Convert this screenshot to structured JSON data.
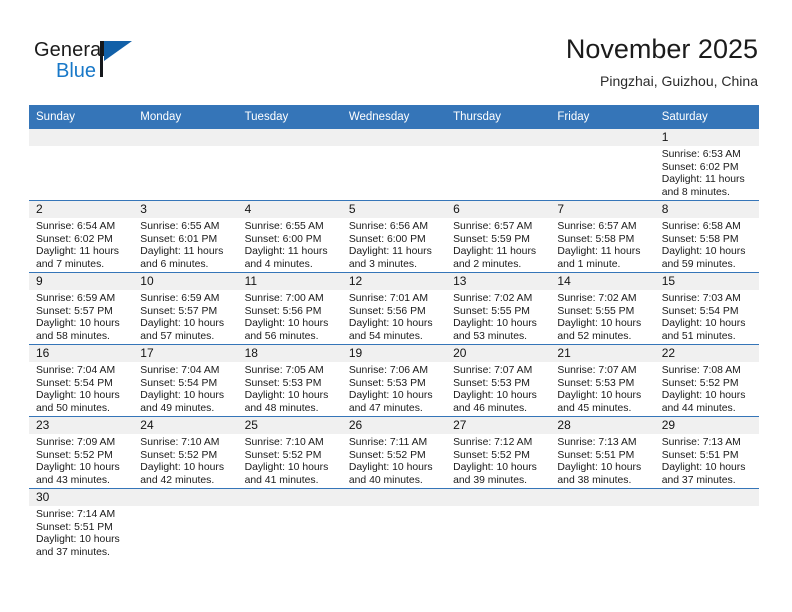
{
  "brand": {
    "name_primary": "General",
    "name_secondary": "Blue",
    "logo_icon": "flag-triangle-icon"
  },
  "header": {
    "title": "November 2025",
    "subtitle": "Pingzhai, Guizhou, China"
  },
  "colors": {
    "header_blue": "#3575b8",
    "brand_blue": "#1878c8",
    "daynum_band": "#f0f0f0",
    "text": "#1a1a1a"
  },
  "weekday_headers": [
    "Sunday",
    "Monday",
    "Tuesday",
    "Wednesday",
    "Thursday",
    "Friday",
    "Saturday"
  ],
  "labels": {
    "sunrise_prefix": "Sunrise:",
    "sunset_prefix": "Sunset:",
    "daylight_prefix": "Daylight:"
  },
  "weeks": [
    [
      {
        "empty": true
      },
      {
        "empty": true
      },
      {
        "empty": true
      },
      {
        "empty": true
      },
      {
        "empty": true
      },
      {
        "empty": true
      },
      {
        "day": "1",
        "sunrise": "Sunrise: 6:53 AM",
        "sunset": "Sunset: 6:02 PM",
        "daylight_line1": "Daylight: 11 hours",
        "daylight_line2": "and 8 minutes."
      }
    ],
    [
      {
        "day": "2",
        "sunrise": "Sunrise: 6:54 AM",
        "sunset": "Sunset: 6:02 PM",
        "daylight_line1": "Daylight: 11 hours",
        "daylight_line2": "and 7 minutes."
      },
      {
        "day": "3",
        "sunrise": "Sunrise: 6:55 AM",
        "sunset": "Sunset: 6:01 PM",
        "daylight_line1": "Daylight: 11 hours",
        "daylight_line2": "and 6 minutes."
      },
      {
        "day": "4",
        "sunrise": "Sunrise: 6:55 AM",
        "sunset": "Sunset: 6:00 PM",
        "daylight_line1": "Daylight: 11 hours",
        "daylight_line2": "and 4 minutes."
      },
      {
        "day": "5",
        "sunrise": "Sunrise: 6:56 AM",
        "sunset": "Sunset: 6:00 PM",
        "daylight_line1": "Daylight: 11 hours",
        "daylight_line2": "and 3 minutes."
      },
      {
        "day": "6",
        "sunrise": "Sunrise: 6:57 AM",
        "sunset": "Sunset: 5:59 PM",
        "daylight_line1": "Daylight: 11 hours",
        "daylight_line2": "and 2 minutes."
      },
      {
        "day": "7",
        "sunrise": "Sunrise: 6:57 AM",
        "sunset": "Sunset: 5:58 PM",
        "daylight_line1": "Daylight: 11 hours",
        "daylight_line2": "and 1 minute."
      },
      {
        "day": "8",
        "sunrise": "Sunrise: 6:58 AM",
        "sunset": "Sunset: 5:58 PM",
        "daylight_line1": "Daylight: 10 hours",
        "daylight_line2": "and 59 minutes."
      }
    ],
    [
      {
        "day": "9",
        "sunrise": "Sunrise: 6:59 AM",
        "sunset": "Sunset: 5:57 PM",
        "daylight_line1": "Daylight: 10 hours",
        "daylight_line2": "and 58 minutes."
      },
      {
        "day": "10",
        "sunrise": "Sunrise: 6:59 AM",
        "sunset": "Sunset: 5:57 PM",
        "daylight_line1": "Daylight: 10 hours",
        "daylight_line2": "and 57 minutes."
      },
      {
        "day": "11",
        "sunrise": "Sunrise: 7:00 AM",
        "sunset": "Sunset: 5:56 PM",
        "daylight_line1": "Daylight: 10 hours",
        "daylight_line2": "and 56 minutes."
      },
      {
        "day": "12",
        "sunrise": "Sunrise: 7:01 AM",
        "sunset": "Sunset: 5:56 PM",
        "daylight_line1": "Daylight: 10 hours",
        "daylight_line2": "and 54 minutes."
      },
      {
        "day": "13",
        "sunrise": "Sunrise: 7:02 AM",
        "sunset": "Sunset: 5:55 PM",
        "daylight_line1": "Daylight: 10 hours",
        "daylight_line2": "and 53 minutes."
      },
      {
        "day": "14",
        "sunrise": "Sunrise: 7:02 AM",
        "sunset": "Sunset: 5:55 PM",
        "daylight_line1": "Daylight: 10 hours",
        "daylight_line2": "and 52 minutes."
      },
      {
        "day": "15",
        "sunrise": "Sunrise: 7:03 AM",
        "sunset": "Sunset: 5:54 PM",
        "daylight_line1": "Daylight: 10 hours",
        "daylight_line2": "and 51 minutes."
      }
    ],
    [
      {
        "day": "16",
        "sunrise": "Sunrise: 7:04 AM",
        "sunset": "Sunset: 5:54 PM",
        "daylight_line1": "Daylight: 10 hours",
        "daylight_line2": "and 50 minutes."
      },
      {
        "day": "17",
        "sunrise": "Sunrise: 7:04 AM",
        "sunset": "Sunset: 5:54 PM",
        "daylight_line1": "Daylight: 10 hours",
        "daylight_line2": "and 49 minutes."
      },
      {
        "day": "18",
        "sunrise": "Sunrise: 7:05 AM",
        "sunset": "Sunset: 5:53 PM",
        "daylight_line1": "Daylight: 10 hours",
        "daylight_line2": "and 48 minutes."
      },
      {
        "day": "19",
        "sunrise": "Sunrise: 7:06 AM",
        "sunset": "Sunset: 5:53 PM",
        "daylight_line1": "Daylight: 10 hours",
        "daylight_line2": "and 47 minutes."
      },
      {
        "day": "20",
        "sunrise": "Sunrise: 7:07 AM",
        "sunset": "Sunset: 5:53 PM",
        "daylight_line1": "Daylight: 10 hours",
        "daylight_line2": "and 46 minutes."
      },
      {
        "day": "21",
        "sunrise": "Sunrise: 7:07 AM",
        "sunset": "Sunset: 5:53 PM",
        "daylight_line1": "Daylight: 10 hours",
        "daylight_line2": "and 45 minutes."
      },
      {
        "day": "22",
        "sunrise": "Sunrise: 7:08 AM",
        "sunset": "Sunset: 5:52 PM",
        "daylight_line1": "Daylight: 10 hours",
        "daylight_line2": "and 44 minutes."
      }
    ],
    [
      {
        "day": "23",
        "sunrise": "Sunrise: 7:09 AM",
        "sunset": "Sunset: 5:52 PM",
        "daylight_line1": "Daylight: 10 hours",
        "daylight_line2": "and 43 minutes."
      },
      {
        "day": "24",
        "sunrise": "Sunrise: 7:10 AM",
        "sunset": "Sunset: 5:52 PM",
        "daylight_line1": "Daylight: 10 hours",
        "daylight_line2": "and 42 minutes."
      },
      {
        "day": "25",
        "sunrise": "Sunrise: 7:10 AM",
        "sunset": "Sunset: 5:52 PM",
        "daylight_line1": "Daylight: 10 hours",
        "daylight_line2": "and 41 minutes."
      },
      {
        "day": "26",
        "sunrise": "Sunrise: 7:11 AM",
        "sunset": "Sunset: 5:52 PM",
        "daylight_line1": "Daylight: 10 hours",
        "daylight_line2": "and 40 minutes."
      },
      {
        "day": "27",
        "sunrise": "Sunrise: 7:12 AM",
        "sunset": "Sunset: 5:52 PM",
        "daylight_line1": "Daylight: 10 hours",
        "daylight_line2": "and 39 minutes."
      },
      {
        "day": "28",
        "sunrise": "Sunrise: 7:13 AM",
        "sunset": "Sunset: 5:51 PM",
        "daylight_line1": "Daylight: 10 hours",
        "daylight_line2": "and 38 minutes."
      },
      {
        "day": "29",
        "sunrise": "Sunrise: 7:13 AM",
        "sunset": "Sunset: 5:51 PM",
        "daylight_line1": "Daylight: 10 hours",
        "daylight_line2": "and 37 minutes."
      }
    ],
    [
      {
        "day": "30",
        "sunrise": "Sunrise: 7:14 AM",
        "sunset": "Sunset: 5:51 PM",
        "daylight_line1": "Daylight: 10 hours",
        "daylight_line2": "and 37 minutes."
      },
      {
        "empty": true
      },
      {
        "empty": true
      },
      {
        "empty": true
      },
      {
        "empty": true
      },
      {
        "empty": true
      },
      {
        "empty": true
      }
    ]
  ]
}
